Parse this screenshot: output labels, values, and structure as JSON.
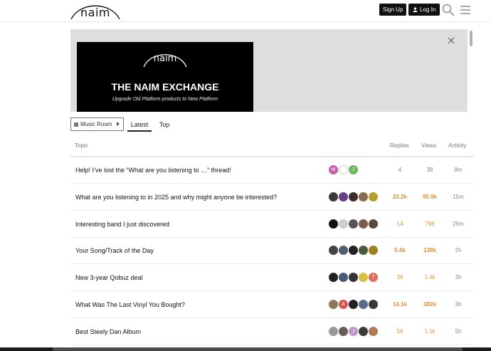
{
  "header": {
    "logo_text": "naim",
    "signup_label": "Sign Up",
    "login_label": "Log In"
  },
  "banner": {
    "logo_text": "naim",
    "title": "THE NAIM EXCHANGE",
    "subtitle": "Upgrade Old Platform products to New Platform"
  },
  "nav": {
    "category": "Music Room",
    "tabs": [
      "Latest",
      "Top"
    ]
  },
  "table": {
    "headers": {
      "topic": "Topic",
      "replies": "Replies",
      "views": "Views",
      "activity": "Activity"
    },
    "rows": [
      {
        "title": "Help! I’ve lost the “What are you listening to …” thread!",
        "replies": "4",
        "views": "38",
        "activity": "8m",
        "heat": "cold",
        "posters": [
          {
            "letter": "M",
            "color": "#c65fa9"
          },
          {
            "letter": "",
            "color": "#ffffff"
          },
          {
            "letter": "J",
            "color": "#6cb85e"
          }
        ]
      },
      {
        "title": "What are you listening to in 2025 and why might anyone be interested?",
        "replies": "23.2k",
        "views": "95.9k",
        "activity": "15m",
        "heat": "hot",
        "posters": [
          {
            "letter": "",
            "color": "#3a3a3a"
          },
          {
            "letter": "",
            "color": "#6b3d8c"
          },
          {
            "letter": "",
            "color": "#3b2d2d"
          },
          {
            "letter": "",
            "color": "#8a6a4a"
          },
          {
            "letter": "",
            "color": "#b8a030"
          }
        ]
      },
      {
        "title": "Interesting band I just discovered",
        "replies": "14",
        "views": "798",
        "activity": "26m",
        "heat": "warm",
        "posters": [
          {
            "letter": "",
            "color": "#111111"
          },
          {
            "letter": "",
            "color": "#cccccc"
          },
          {
            "letter": "",
            "color": "#555555"
          },
          {
            "letter": "",
            "color": "#7a5a4a"
          },
          {
            "letter": "",
            "color": "#5a4a3a"
          }
        ]
      },
      {
        "title": "Your Song/Track of the Day",
        "replies": "5.4k",
        "views": "138k",
        "activity": "2h",
        "heat": "hot",
        "posters": [
          {
            "letter": "",
            "color": "#444444"
          },
          {
            "letter": "",
            "color": "#506070"
          },
          {
            "letter": "",
            "color": "#222222"
          },
          {
            "letter": "",
            "color": "#4a5a3a"
          },
          {
            "letter": "",
            "color": "#a08020"
          }
        ]
      },
      {
        "title": "New 3-year Qobuz deal",
        "replies": "36",
        "views": "1.4k",
        "activity": "3h",
        "heat": "warm",
        "posters": [
          {
            "letter": "",
            "color": "#222222"
          },
          {
            "letter": "",
            "color": "#4a5a7a"
          },
          {
            "letter": "",
            "color": "#333333"
          },
          {
            "letter": "",
            "color": "#d8c040"
          },
          {
            "letter": "T",
            "color": "#e26a5a"
          }
        ]
      },
      {
        "title": "What Was The Last Vinyl You Bought?",
        "replies": "14.1k",
        "views": "382k",
        "activity": "3h",
        "heat": "hot",
        "posters": [
          {
            "letter": "",
            "color": "#8a7a5a"
          },
          {
            "letter": "A",
            "color": "#d9534f"
          },
          {
            "letter": "",
            "color": "#222222"
          },
          {
            "letter": "",
            "color": "#5a6a8a"
          },
          {
            "letter": "",
            "color": "#3a3a3a"
          }
        ]
      },
      {
        "title": "Best Steely Dan Album",
        "replies": "56",
        "views": "1.1k",
        "activity": "5h",
        "heat": "warm",
        "posters": [
          {
            "letter": "",
            "color": "#999999"
          },
          {
            "letter": "",
            "color": "#6a5a5a"
          },
          {
            "letter": "J",
            "color": "#c095c9"
          },
          {
            "letter": "",
            "color": "#3a3a3a"
          },
          {
            "letter": "",
            "color": "#b07a5a"
          }
        ]
      }
    ]
  }
}
